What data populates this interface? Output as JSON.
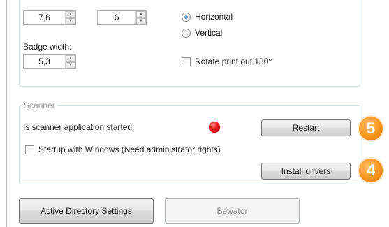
{
  "print_settings": {
    "spin1_value": "7,6",
    "spin2_value": "6",
    "badge_width_label": "Badge width:",
    "badge_width_value": "5,3",
    "orientation_horizontal": "Horizontal",
    "orientation_vertical": "Vertical",
    "orientation_selected": "Horizontal",
    "rotate_label": "Rotate print out 180°",
    "rotate_checked": false
  },
  "scanner": {
    "group_label": "Scanner",
    "status_label": "Is scanner application started:",
    "status_indicator_color": "#e81818",
    "restart_label": "Restart",
    "startup_label": "Startup with Windows (Need administrator rights)",
    "startup_checked": false,
    "install_drivers_label": "Install drivers"
  },
  "callouts": {
    "restart_step": "5",
    "install_step": "4",
    "color": "#f7941d"
  },
  "bottom_buttons": {
    "ad_settings_label": "Active Directory Settings",
    "bewator_label": "Bewator"
  }
}
